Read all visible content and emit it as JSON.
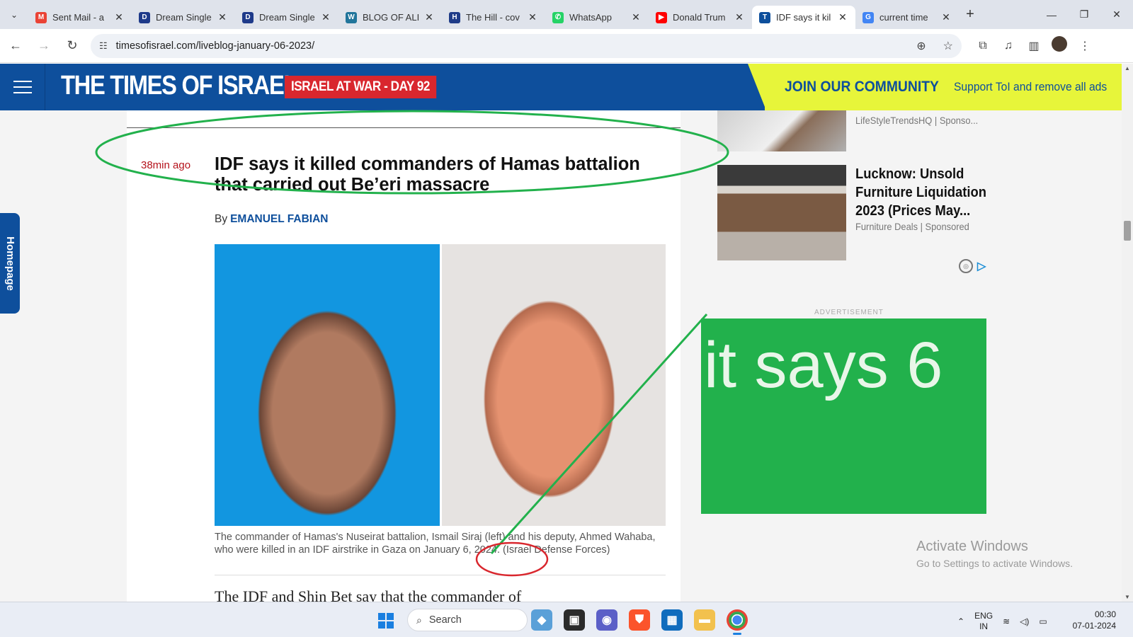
{
  "browser": {
    "tabs": [
      {
        "title": "Sent Mail - a",
        "icon": "gmail-icon",
        "color": "#ea4335",
        "glyph": "M"
      },
      {
        "title": "Dream Single",
        "icon": "dream-icon",
        "color": "#1e3a8a",
        "glyph": "D"
      },
      {
        "title": "Dream Single",
        "icon": "dream-icon",
        "color": "#1e3a8a",
        "glyph": "D"
      },
      {
        "title": "BLOG OF ALI",
        "icon": "wordpress-icon",
        "color": "#21759b",
        "glyph": "W"
      },
      {
        "title": "The Hill - cov",
        "icon": "thehill-icon",
        "color": "#1f3c88",
        "glyph": "H"
      },
      {
        "title": "WhatsApp",
        "icon": "whatsapp-icon",
        "color": "#25d366",
        "glyph": "✆"
      },
      {
        "title": "Donald Trum",
        "icon": "youtube-icon",
        "color": "#ff0000",
        "glyph": "▶"
      },
      {
        "title": "IDF says it kil",
        "icon": "timesofisrael-icon",
        "color": "#0e4f9c",
        "glyph": "T"
      },
      {
        "title": "current time",
        "icon": "google-icon",
        "color": "#4285f4",
        "glyph": "G"
      }
    ],
    "url": "timesofisrael.com/liveblog-january-06-2023/"
  },
  "site": {
    "logo": "THE TIMES OF ISRAEL",
    "war_badge": "ISRAEL AT WAR - DAY 92",
    "join": "JOIN OUR COMMUNITY",
    "support": "Support ToI and remove all ads",
    "home_tab": "Homepage"
  },
  "article": {
    "time_ago": "38min ago",
    "headline": "IDF says it killed commanders of Hamas battalion that carried out Be’eri massacre",
    "by": "By",
    "author": "EMANUEL FABIAN",
    "caption": "The commander of Hamas's Nuseirat battalion, Ismail Siraj (left) and his deputy, Ahmed Wahaba, who were killed in an IDF airstrike in Gaza on January 6, 2024. (Israel Defense Forces)",
    "body_peek": "The IDF and Shin Bet say that the commander of"
  },
  "sidebar": {
    "ad_a_source": "LifeStyleTrendsHQ | Sponso...",
    "ad_b_title": "Lucknow: Unsold Furniture Liquidation 2023 (Prices May...",
    "ad_b_source": "Furniture Deals | Sponsored",
    "advertisement": "ADVERTISEMENT"
  },
  "annotation": {
    "note": "it says 6",
    "color": "#22b14c",
    "circle_color": "#d9272e"
  },
  "watermark": {
    "line1": "Activate Windows",
    "line2": "Go to Settings to activate Windows."
  },
  "taskbar": {
    "search": "Search",
    "lang_top": "ENG",
    "lang_bottom": "IN",
    "time": "00:30",
    "date": "07-01-2024"
  }
}
